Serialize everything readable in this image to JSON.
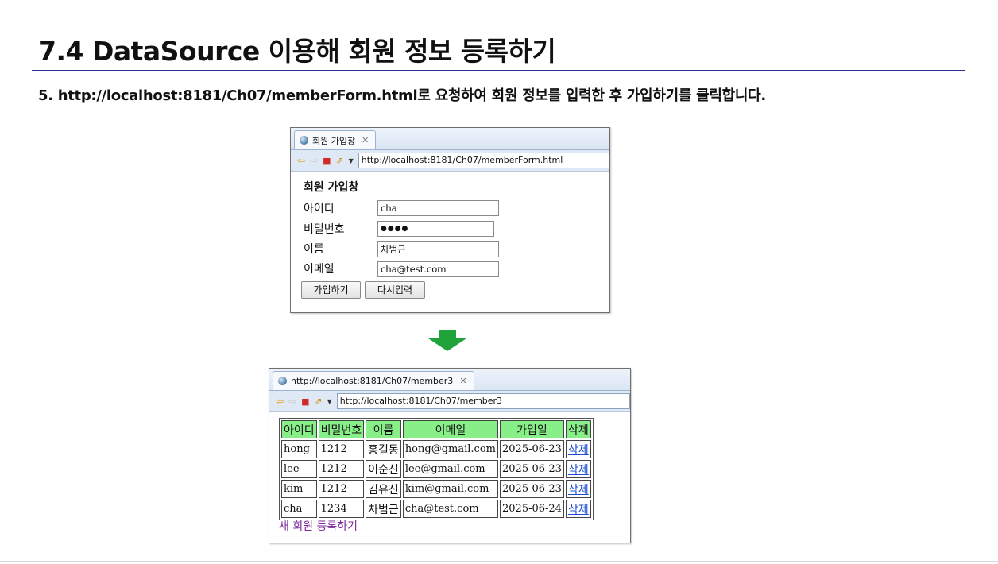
{
  "slide": {
    "title": "7.4 DataSource 이용해 회원 정보 등록하기",
    "step": "5. http://localhost:8181/Ch07/memberForm.html로 요청하여 회원 정보를 입력한 후 가입하기를 클릭합니다."
  },
  "form_window": {
    "tab_label": "회원 가입창",
    "url": "http://localhost:8181/Ch07/memberForm.html",
    "heading": "회원 가입창",
    "fields": [
      {
        "label": "아이디",
        "value": "cha"
      },
      {
        "label": "비밀번호",
        "value": "●●●●"
      },
      {
        "label": "이름",
        "value": "차범근"
      },
      {
        "label": "이메일",
        "value": "cha@test.com"
      }
    ],
    "submit_label": "가입하기",
    "reset_label": "다시입력"
  },
  "result_window": {
    "tab_label": "http://localhost:8181/Ch07/member3",
    "url": "http://localhost:8181/Ch07/member3",
    "columns": [
      "아이디",
      "비밀번호",
      "이름",
      "이메일",
      "가입일",
      "삭제"
    ],
    "rows": [
      {
        "id": "hong",
        "pwd": "1212",
        "name": "홍길동",
        "email": "hong@gmail.com",
        "date": "2025-06-23",
        "del": "삭제"
      },
      {
        "id": "lee",
        "pwd": "1212",
        "name": "이순신",
        "email": "lee@gmail.com",
        "date": "2025-06-23",
        "del": "삭제"
      },
      {
        "id": "kim",
        "pwd": "1212",
        "name": "김유신",
        "email": "kim@gmail.com",
        "date": "2025-06-23",
        "del": "삭제"
      },
      {
        "id": "cha",
        "pwd": "1234",
        "name": "차범근",
        "email": "cha@test.com",
        "date": "2025-06-24",
        "del": "삭제"
      }
    ],
    "new_member_link": "새 회원 등록하기"
  },
  "colors": {
    "title_rule": "#2e3192",
    "arrow": "#1fa33a",
    "table_header": "#88ee88"
  }
}
